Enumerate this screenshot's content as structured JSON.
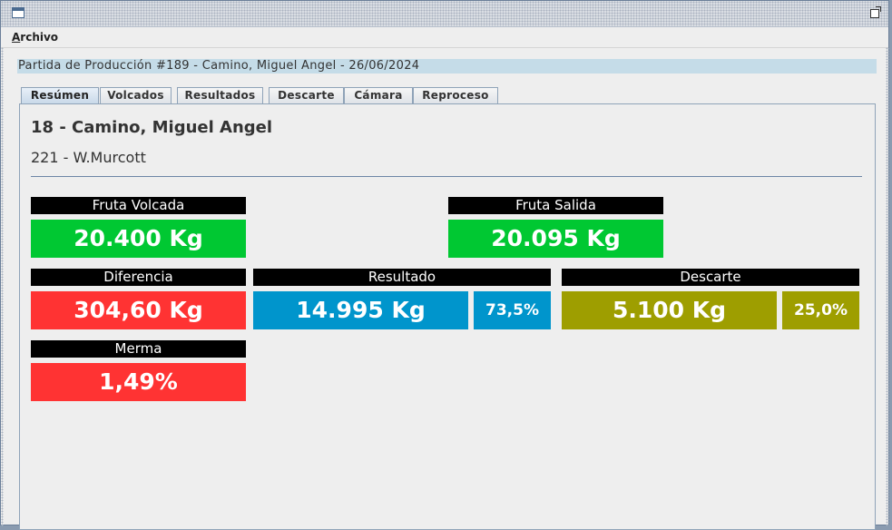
{
  "window": {
    "icon": "window-icon",
    "maximize_icon": "maximize-icon"
  },
  "menu": {
    "archivo": "Archivo"
  },
  "header": {
    "title": "Partida de Producción #189 - Camino, Miguel Angel - 26/06/2024"
  },
  "tabs": [
    {
      "label": "Resúmen",
      "active": true
    },
    {
      "label": "Volcados",
      "active": false
    },
    {
      "label": "Resultados",
      "active": false
    },
    {
      "label": "Descarte",
      "active": false
    },
    {
      "label": "Cámara",
      "active": false
    },
    {
      "label": "Reproceso",
      "active": false
    }
  ],
  "summary": {
    "client": "18 - Camino, Miguel Angel",
    "variety": "221 - W.Murcott",
    "fruta_volcada": {
      "label": "Fruta Volcada",
      "value": "20.400 Kg"
    },
    "fruta_salida": {
      "label": "Fruta Salida",
      "value": "20.095 Kg"
    },
    "diferencia": {
      "label": "Diferencia",
      "value": "304,60 Kg"
    },
    "resultado": {
      "label": "Resultado",
      "value": "14.995 Kg",
      "percent": "73,5%"
    },
    "descarte": {
      "label": "Descarte",
      "value": "5.100 Kg",
      "percent": "25,0%"
    },
    "merma": {
      "label": "Merma",
      "value": "1,49%"
    }
  },
  "colors": {
    "green": "#00c832",
    "red": "#ff3333",
    "blue": "#0095cc",
    "olive": "#9e9e00",
    "header_bg": "#c5dce8"
  }
}
